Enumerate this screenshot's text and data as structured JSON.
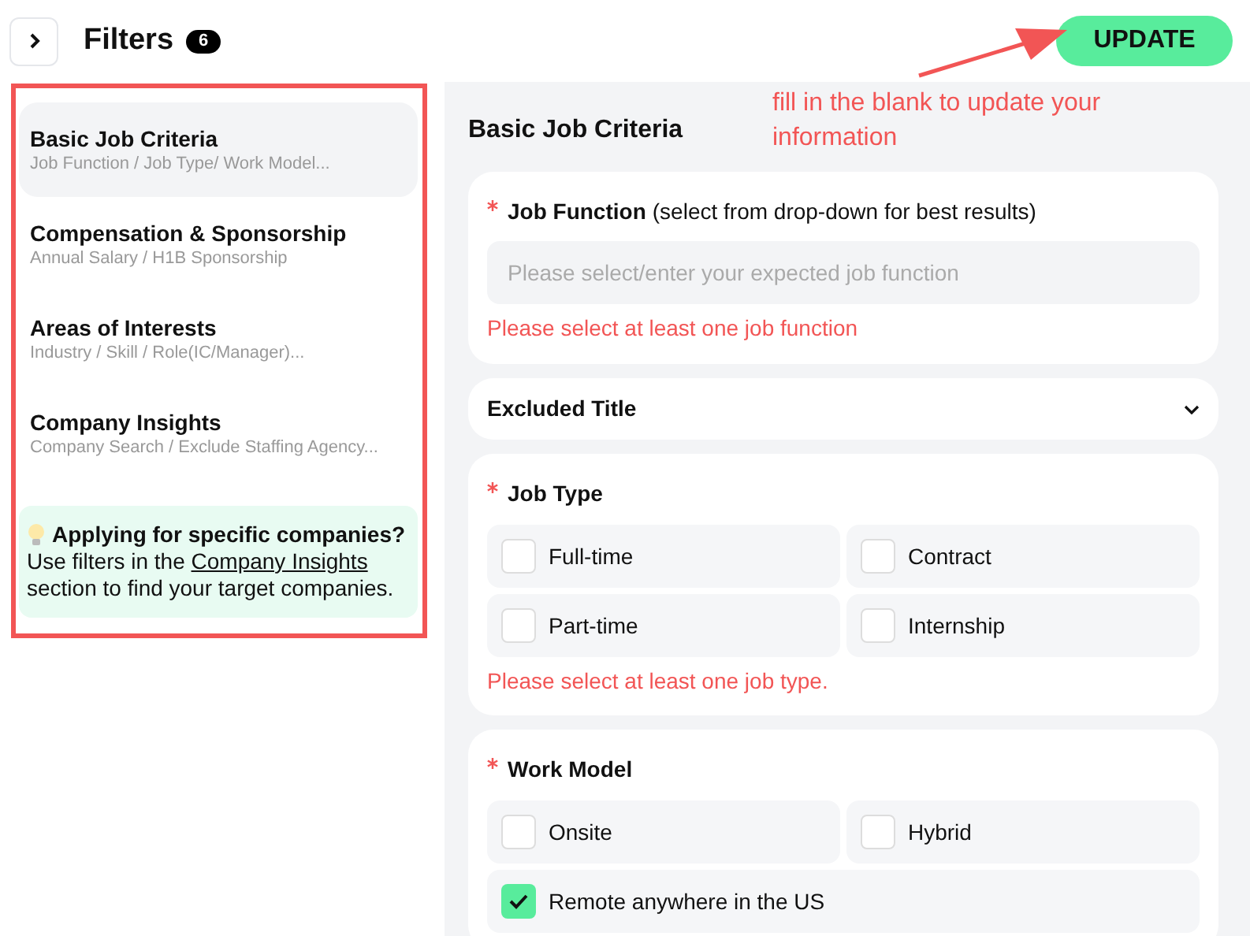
{
  "header": {
    "title": "Filters",
    "count": "6",
    "update_button": "UPDATE"
  },
  "sidebar": {
    "items": [
      {
        "title": "Basic Job Criteria",
        "subtitle": "Job Function / Job Type/ Work Model...",
        "selected": true
      },
      {
        "title": "Compensation & Sponsorship",
        "subtitle": "Annual Salary / H1B Sponsorship",
        "selected": false
      },
      {
        "title": "Areas of Interests",
        "subtitle": "Industry / Skill / Role(IC/Manager)...",
        "selected": false
      },
      {
        "title": "Company Insights",
        "subtitle": "Company Search / Exclude Staffing Agency...",
        "selected": false
      }
    ],
    "tip": {
      "title": "Applying for specific companies?",
      "text_before": "Use filters in the",
      "link": "Company Insights",
      "text_after": "section to find your target companies."
    }
  },
  "annotation": {
    "text": "fill in the blank to update your information"
  },
  "main": {
    "heading": "Basic Job Criteria",
    "sections": [
      {
        "kind": "field",
        "label": "Job Function",
        "hint": "(select from drop-down for best results)",
        "required": true,
        "placeholder": "Please select/enter your expected job function",
        "error": "Please select at least one job function"
      },
      {
        "kind": "collapsible",
        "label": "Excluded Title",
        "expanded": false
      },
      {
        "kind": "checkboxes",
        "label": "Job Type",
        "required": true,
        "options": [
          {
            "label": "Full-time",
            "checked": false
          },
          {
            "label": "Contract",
            "checked": false
          },
          {
            "label": "Part-time",
            "checked": false
          },
          {
            "label": "Internship",
            "checked": false
          }
        ],
        "error": "Please select at least one job type."
      },
      {
        "kind": "checkboxes",
        "label": "Work Model",
        "required": true,
        "options": [
          {
            "label": "Onsite",
            "checked": false
          },
          {
            "label": "Hybrid",
            "checked": false
          },
          {
            "label": "Remote anywhere in the US",
            "checked": true
          }
        ]
      }
    ]
  }
}
